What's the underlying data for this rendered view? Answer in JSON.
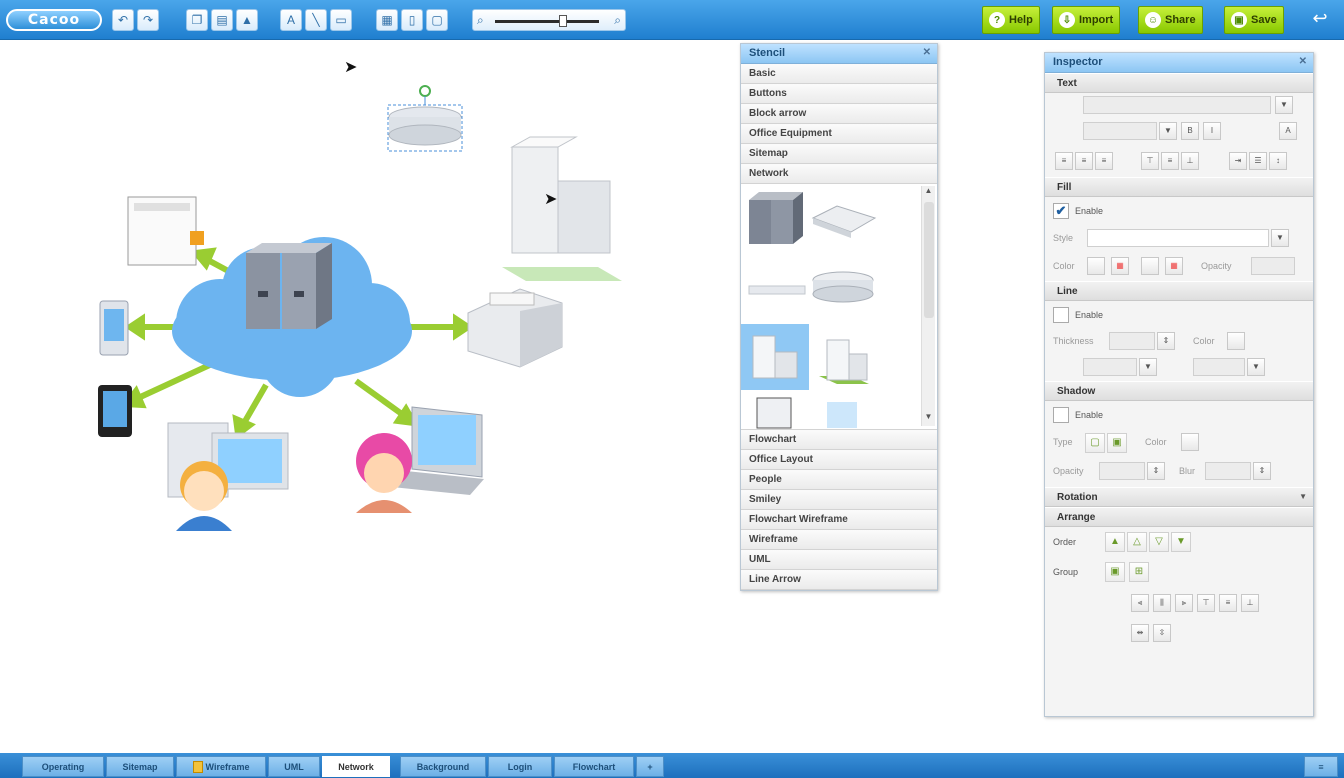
{
  "app": {
    "logo": "Cacoo"
  },
  "toolbar": {
    "undo_icon": "undo-icon",
    "redo_icon": "redo-icon",
    "right_buttons": [
      {
        "label": "Help",
        "icon": "help-icon"
      },
      {
        "label": "Import",
        "icon": "import-icon"
      },
      {
        "label": "Share",
        "icon": "share-icon"
      },
      {
        "label": "Save",
        "icon": "save-icon"
      }
    ]
  },
  "stencil": {
    "title": "Stencil",
    "categories_top": [
      "Basic",
      "Buttons",
      "Block arrow",
      "Office Equipment",
      "Sitemap",
      "Network"
    ],
    "categories_bottom": [
      "Flowchart",
      "Office Layout",
      "People",
      "Smiley",
      "Flowchart Wireframe",
      "Wireframe",
      "UML",
      "Line Arrow"
    ]
  },
  "inspector": {
    "title": "Inspector",
    "sections": {
      "text": "Text",
      "fill": "Fill",
      "line": "Line",
      "shadow": "Shadow",
      "rotation": "Rotation",
      "arrange": "Arrange"
    },
    "fill": {
      "enable_label": "Enable",
      "style_label": "Style",
      "color_label": "Color",
      "opacity_label": "Opacity"
    },
    "line": {
      "enable_label": "Enable",
      "thickness_label": "Thickness",
      "color_label": "Color"
    },
    "shadow": {
      "enable_label": "Enable",
      "type_label": "Type",
      "color_label": "Color",
      "opacity_label": "Opacity",
      "blur_label": "Blur"
    },
    "arrange": {
      "order_label": "Order",
      "group_label": "Group"
    }
  },
  "tabs": [
    {
      "label": "Operating",
      "active": false
    },
    {
      "label": "Sitemap",
      "active": false
    },
    {
      "label": "Wireframe",
      "active": false
    },
    {
      "label": "UML",
      "active": false
    },
    {
      "label": "Network",
      "active": true
    },
    {
      "label": "Background",
      "active": false
    },
    {
      "label": "Login",
      "active": false
    },
    {
      "label": "Flowchart",
      "active": false
    }
  ],
  "colors": {
    "toolbar_blue": "#2d8fd8",
    "action_green": "#9ad700",
    "cloud_blue": "#6cb4f0",
    "arrow_green": "#9acd32"
  }
}
